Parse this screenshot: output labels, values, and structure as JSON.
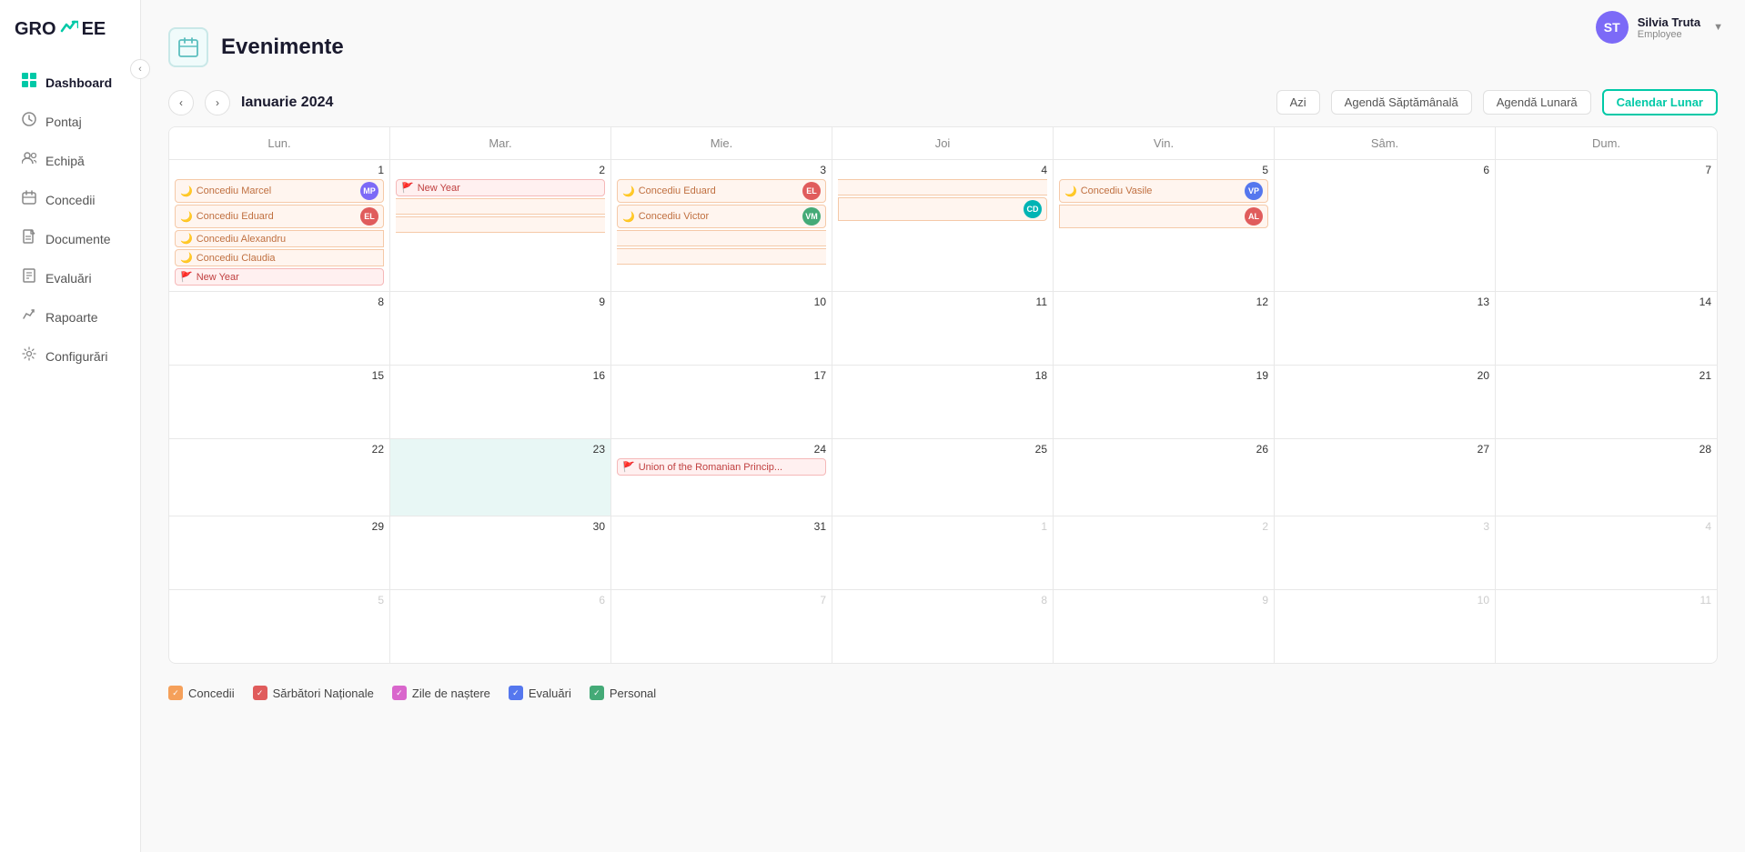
{
  "app": {
    "logo": "GRO EE"
  },
  "user": {
    "name": "Silvia Truta",
    "role": "Employee",
    "initials": "ST"
  },
  "sidebar": {
    "items": [
      {
        "id": "dashboard",
        "label": "Dashboard",
        "icon": "📊",
        "active": true
      },
      {
        "id": "pontaj",
        "label": "Pontaj",
        "icon": "🕐"
      },
      {
        "id": "echipa",
        "label": "Echipă",
        "icon": "👥"
      },
      {
        "id": "concedii",
        "label": "Concedii",
        "icon": "🏖"
      },
      {
        "id": "documente",
        "label": "Documente",
        "icon": "📄"
      },
      {
        "id": "evaluari",
        "label": "Evaluări",
        "icon": "📋"
      },
      {
        "id": "rapoarte",
        "label": "Rapoarte",
        "icon": "📈"
      },
      {
        "id": "configurari",
        "label": "Configurări",
        "icon": "⚙️"
      }
    ]
  },
  "page": {
    "title": "Evenimente",
    "icon": "📅"
  },
  "calendar": {
    "month_label": "Ianuarie 2024",
    "today_label": "Azi",
    "view_weekly": "Agendă Săptămânală",
    "view_monthly_agenda": "Agendă Lunară",
    "view_monthly": "Calendar Lunar",
    "days_header": [
      "Lun.",
      "Mar.",
      "Mie.",
      "Joi",
      "Vin.",
      "Sâm.",
      "Dum."
    ],
    "weeks": [
      {
        "days": [
          {
            "num": 1,
            "current": true,
            "events": [
              {
                "type": "leave",
                "label": "Concediu Marcel",
                "avatar": "MP",
                "avatarColor": "#7c6af7"
              },
              {
                "type": "leave",
                "label": "Concediu Eduard",
                "avatar": "EL",
                "avatarColor": "#e05c5c"
              },
              {
                "type": "leave-span-start",
                "label": "Concediu Alexandru",
                "spanEnd": 5
              },
              {
                "type": "leave-span-start",
                "label": "Concediu Claudia",
                "spanEnd": 4
              },
              {
                "type": "holiday",
                "label": "New Year"
              }
            ]
          },
          {
            "num": 2,
            "current": true,
            "events": [
              {
                "type": "holiday",
                "label": "New Year"
              }
            ]
          },
          {
            "num": 3,
            "current": true,
            "events": [
              {
                "type": "leave",
                "label": "Concediu Eduard",
                "avatar": "EL",
                "avatarColor": "#e05c5c"
              },
              {
                "type": "leave",
                "label": "Concediu Victor",
                "avatar": "VM",
                "avatarColor": "#44aa77"
              }
            ]
          },
          {
            "num": 4,
            "current": true,
            "events": []
          },
          {
            "num": 5,
            "current": true,
            "events": [
              {
                "type": "leave",
                "label": "Concediu Vasile",
                "avatar": "VP",
                "avatarColor": "#5577ee"
              }
            ]
          },
          {
            "num": 6,
            "current": true,
            "events": []
          },
          {
            "num": 7,
            "current": true,
            "events": []
          }
        ]
      },
      {
        "days": [
          {
            "num": 8,
            "current": true,
            "events": []
          },
          {
            "num": 9,
            "current": true,
            "events": []
          },
          {
            "num": 10,
            "current": true,
            "events": []
          },
          {
            "num": 11,
            "current": true,
            "events": []
          },
          {
            "num": 12,
            "current": true,
            "events": []
          },
          {
            "num": 13,
            "current": true,
            "events": []
          },
          {
            "num": 14,
            "current": true,
            "events": []
          }
        ]
      },
      {
        "days": [
          {
            "num": 15,
            "current": true,
            "events": []
          },
          {
            "num": 16,
            "current": true,
            "events": []
          },
          {
            "num": 17,
            "current": true,
            "events": []
          },
          {
            "num": 18,
            "current": true,
            "events": []
          },
          {
            "num": 19,
            "current": true,
            "events": []
          },
          {
            "num": 20,
            "current": true,
            "events": []
          },
          {
            "num": 21,
            "current": true,
            "events": []
          }
        ]
      },
      {
        "days": [
          {
            "num": 22,
            "current": true,
            "events": []
          },
          {
            "num": 23,
            "current": true,
            "today": true,
            "events": []
          },
          {
            "num": 24,
            "current": true,
            "events": [
              {
                "type": "national",
                "label": "Union of the Romanian Princip..."
              }
            ]
          },
          {
            "num": 25,
            "current": true,
            "events": []
          },
          {
            "num": 26,
            "current": true,
            "events": []
          },
          {
            "num": 27,
            "current": true,
            "events": []
          },
          {
            "num": 28,
            "current": true,
            "events": []
          }
        ]
      },
      {
        "days": [
          {
            "num": 29,
            "current": true,
            "events": []
          },
          {
            "num": 30,
            "current": true,
            "events": []
          },
          {
            "num": 31,
            "current": true,
            "events": []
          },
          {
            "num": 1,
            "current": false,
            "events": []
          },
          {
            "num": 2,
            "current": false,
            "events": []
          },
          {
            "num": 3,
            "current": false,
            "events": []
          },
          {
            "num": 4,
            "current": false,
            "events": []
          }
        ]
      },
      {
        "days": [
          {
            "num": 5,
            "current": false,
            "events": []
          },
          {
            "num": 6,
            "current": false,
            "events": []
          },
          {
            "num": 7,
            "current": false,
            "events": []
          },
          {
            "num": 8,
            "current": false,
            "events": []
          },
          {
            "num": 9,
            "current": false,
            "events": []
          },
          {
            "num": 10,
            "current": false,
            "events": []
          },
          {
            "num": 11,
            "current": false,
            "events": []
          }
        ]
      }
    ],
    "spanning_events": [
      {
        "label": "Concediu Alexandru",
        "startCol": 1,
        "endCol": 5,
        "weekRow": 0,
        "avatarColor": "#e05c5c",
        "avatar": "AL"
      },
      {
        "label": "Concediu Claudia",
        "startCol": 1,
        "endCol": 4,
        "weekRow": 0,
        "avatarColor": "#00b4b4",
        "avatar": "CD"
      }
    ]
  },
  "legend": {
    "items": [
      {
        "id": "concedii",
        "label": "Concedii",
        "colorClass": "lc-concedii"
      },
      {
        "id": "sarbatori",
        "label": "Sărbători Naționale",
        "colorClass": "lc-sarbatori"
      },
      {
        "id": "nastere",
        "label": "Zile de naștere",
        "colorClass": "lc-nastere"
      },
      {
        "id": "evaluari",
        "label": "Evaluări",
        "colorClass": "lc-evaluari"
      },
      {
        "id": "personal",
        "label": "Personal",
        "colorClass": "lc-personal"
      }
    ]
  }
}
